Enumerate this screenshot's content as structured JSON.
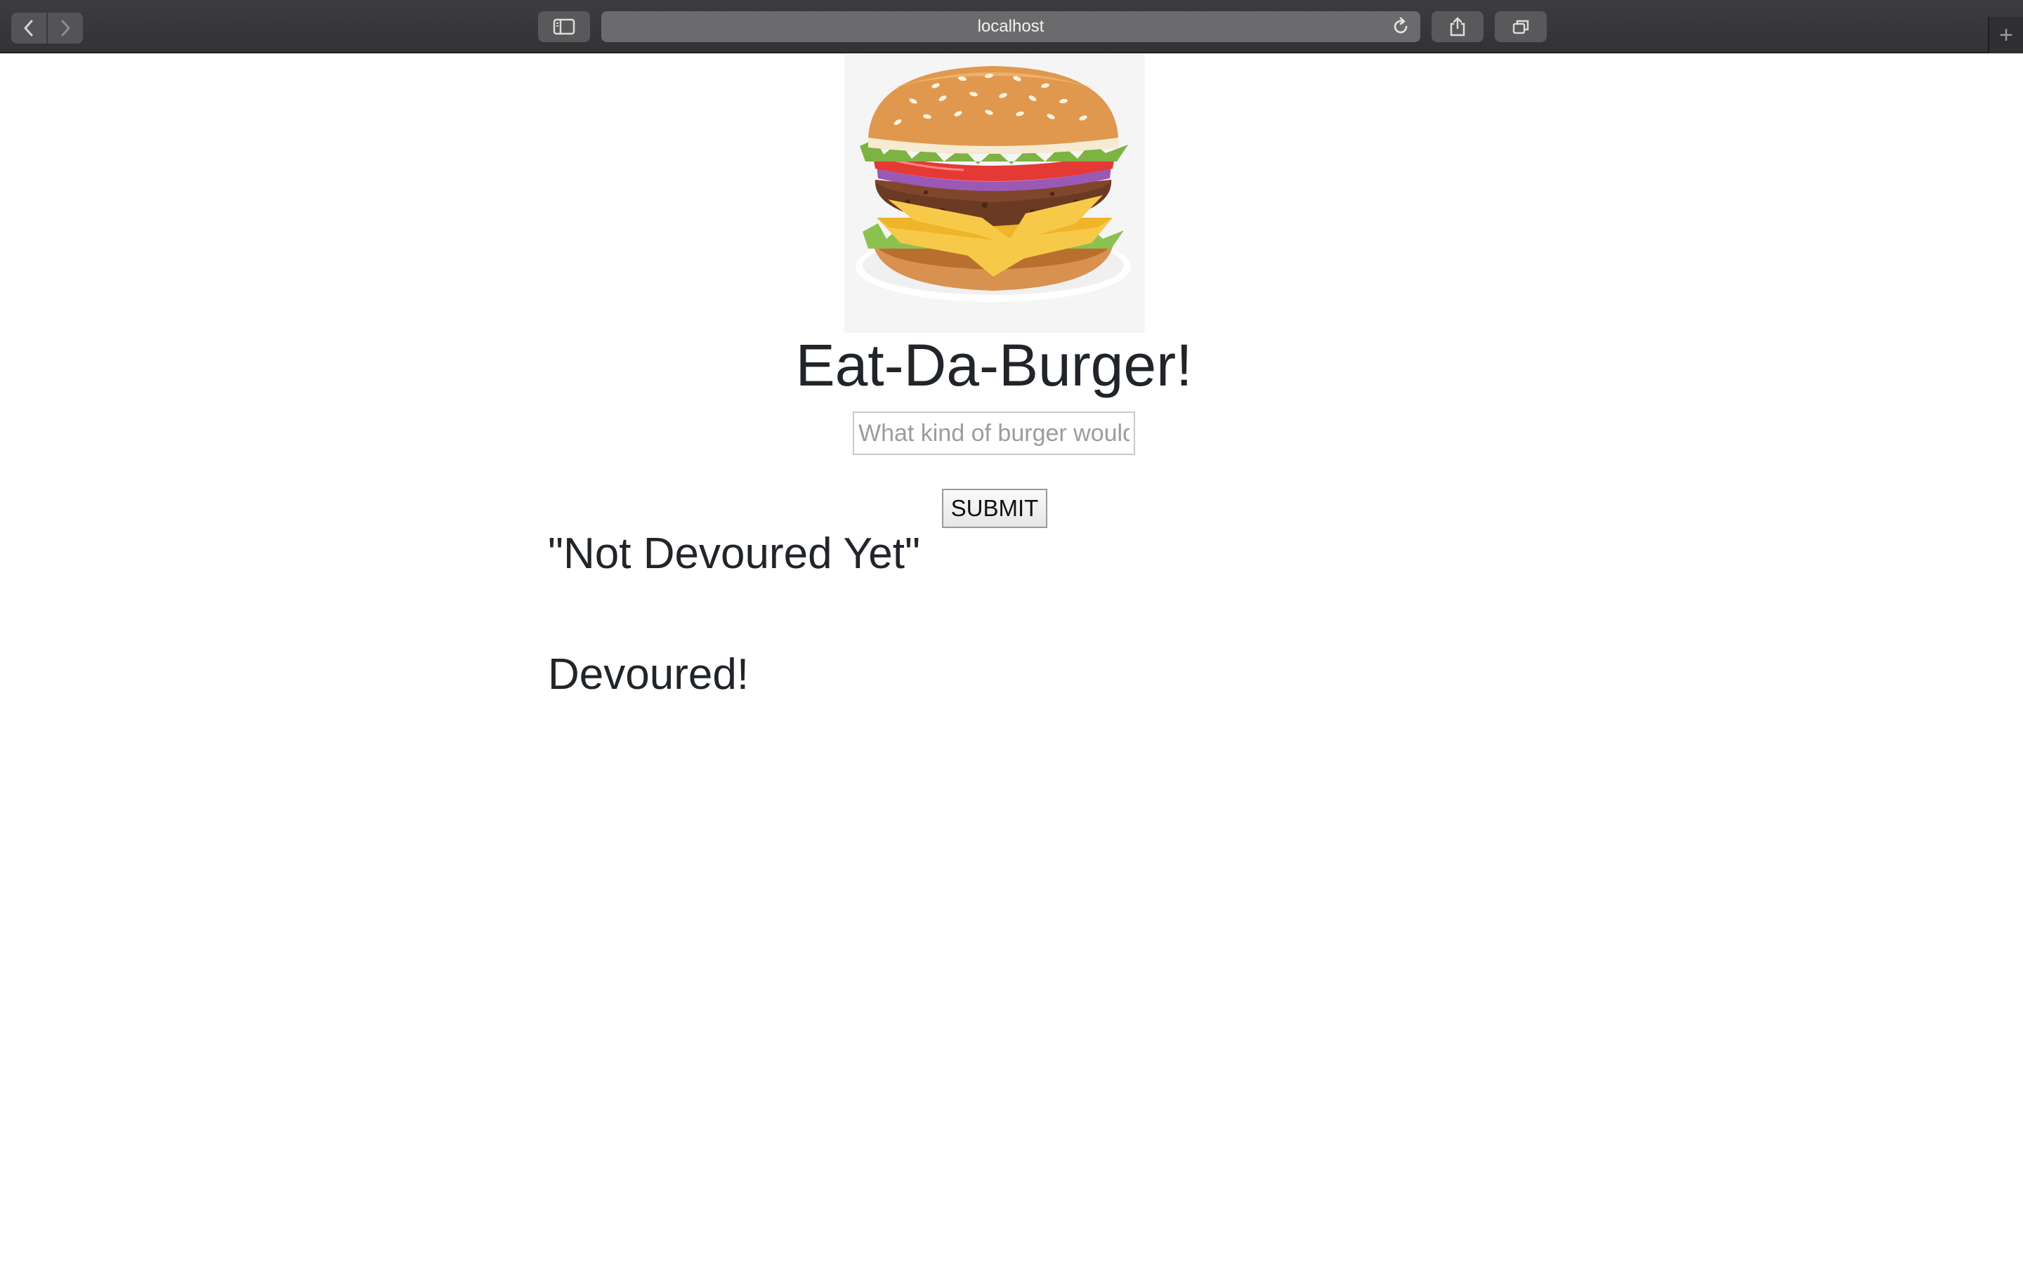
{
  "browser": {
    "url": "localhost",
    "icons": {
      "back": "chevron-left-icon",
      "forward": "chevron-right-icon",
      "sidebar": "sidebar-icon",
      "reload": "reload-icon",
      "share": "share-icon",
      "tabs": "tabs-overview-icon",
      "new_tab": "plus-icon"
    },
    "new_tab_label": "+"
  },
  "page": {
    "title": "Eat-Da-Burger!",
    "hero_image": "hamburger",
    "form": {
      "placeholder": "What kind of burger would",
      "submit_label": "SUBMIT"
    },
    "sections": {
      "not_devoured": "\"Not Devoured Yet\"",
      "devoured": "Devoured!"
    }
  },
  "colors": {
    "text": "#212529",
    "toolbar": "#3a3a3c",
    "address_bar": "#6b6b6d"
  }
}
